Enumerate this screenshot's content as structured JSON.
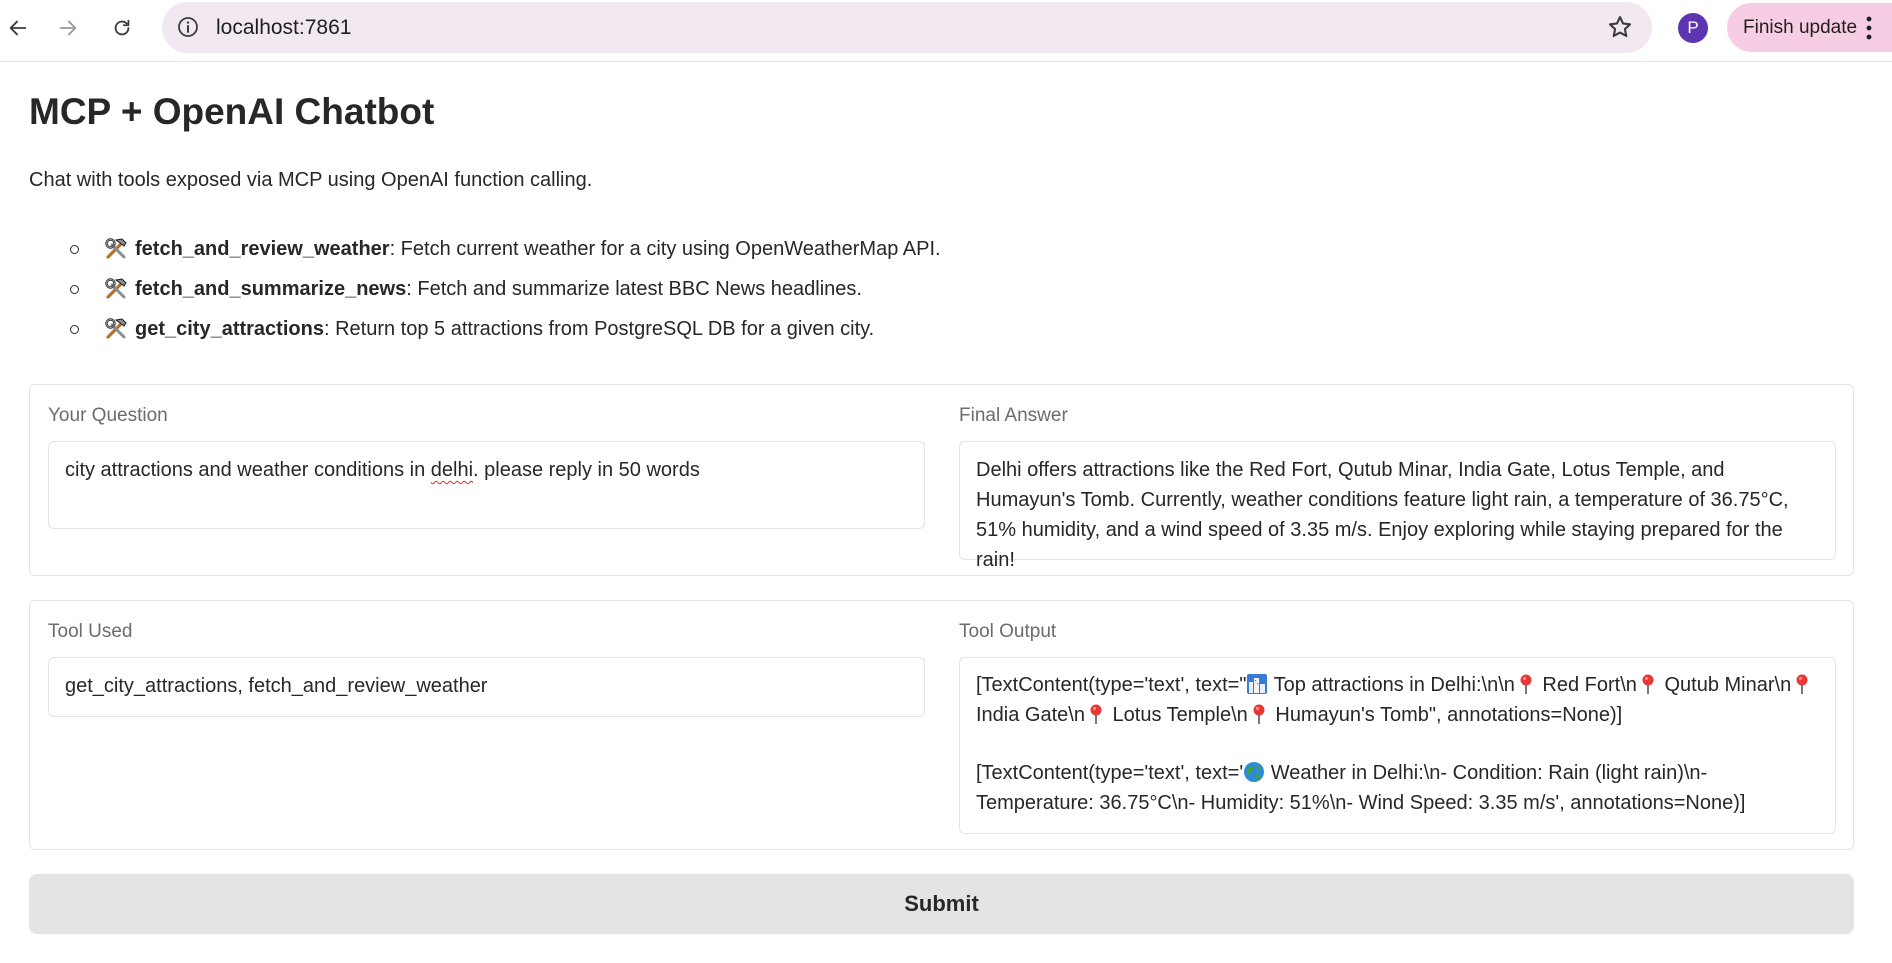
{
  "browser": {
    "url": "localhost:7861",
    "avatar_letter": "P",
    "update_label": "Finish update"
  },
  "page": {
    "title": "MCP + OpenAI Chatbot",
    "description": "Chat with tools exposed via MCP using OpenAI function calling.",
    "tools": [
      {
        "name": "fetch_and_review_weather",
        "description": ": Fetch current weather for a city using OpenWeatherMap API."
      },
      {
        "name": "fetch_and_summarize_news",
        "description": ": Fetch and summarize latest BBC News headlines."
      },
      {
        "name": "get_city_attractions",
        "description": ": Return top 5 attractions from PostgreSQL DB for a given city."
      }
    ]
  },
  "question": {
    "label": "Your Question",
    "value_before": "city attractions and weather conditions in ",
    "value_misspelled": "delhi",
    "value_after": ". please reply in 50 words"
  },
  "answer": {
    "label": "Final Answer",
    "value": "Delhi offers attractions like the Red Fort, Qutub Minar, India Gate, Lotus Temple, and Humayun's Tomb. Currently, weather conditions feature light rain, a temperature of 36.75°C, 51% humidity, and a wind speed of 3.35 m/s. Enjoy exploring while staying prepared for the rain!"
  },
  "tool_used": {
    "label": "Tool Used",
    "value": "get_city_attractions, fetch_and_review_weather"
  },
  "tool_output": {
    "label": "Tool Output",
    "line1_a": "[TextContent(type='text', text=\"",
    "line1_b": " Top attractions in Delhi:\\n\\n",
    "line1_c": " Red Fort\\n",
    "line1_d": " Qutub Minar\\n",
    "line1_e": " India Gate\\n",
    "line1_f": " Lotus Temple\\n",
    "line1_g": " Humayun's Tomb\", annotations=None)]",
    "line2_a": "[TextContent(type='text', text='",
    "line2_b": " Weather in Delhi:\\n- Condition: Rain (light rain)\\n- Temperature: 36.75°C\\n- Humidity: 51%\\n- Wind Speed: 3.35 m/s', annotations=None)]"
  },
  "submit_label": "Submit",
  "icons": {
    "tool": "hammer-and-wrench-icon",
    "city": "cityscape-icon",
    "pin": "round-pushpin-icon",
    "globe": "globe-icon"
  }
}
